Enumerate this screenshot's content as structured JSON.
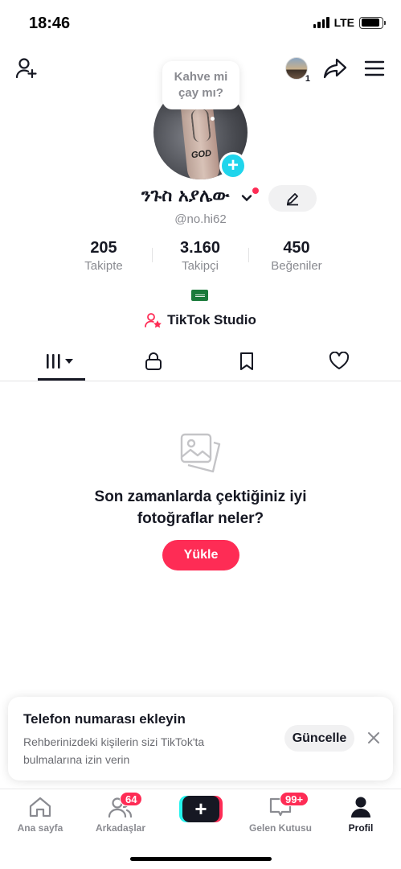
{
  "status_bar": {
    "time": "18:46",
    "network": "LTE",
    "battery_level": 0.9
  },
  "profile": {
    "bubble_text": "Kahve mi çay mı?",
    "avatar_tattoo_text": "GOD",
    "display_name": "ንጉስ አያሌው",
    "handle": "@no.hi62",
    "stats": [
      {
        "value": "205",
        "label": "Takipte"
      },
      {
        "value": "3.160",
        "label": "Takipçi"
      },
      {
        "value": "450",
        "label": "Beğeniler"
      }
    ],
    "flag_icon": "saudi-arabia-flag",
    "studio_label": "TikTok Studio"
  },
  "story": {
    "count": "1"
  },
  "tabs": [
    {
      "name": "videos-tab",
      "icon": "grid-bars-icon",
      "active": true
    },
    {
      "name": "private-tab",
      "icon": "lock-icon"
    },
    {
      "name": "saved-tab",
      "icon": "bookmark-icon"
    },
    {
      "name": "liked-tab",
      "icon": "heart-icon"
    }
  ],
  "empty_state": {
    "icon": "photos-icon",
    "title": "Son zamanlarda çektiğiniz iyi fotoğraflar neler?",
    "button": "Yükle"
  },
  "phone_card": {
    "title": "Telefon numarası ekleyin",
    "description": "Rehberinizdeki kişilerin sizi TikTok'ta bulmalarına izin verin",
    "button": "Güncelle"
  },
  "bottom_nav": {
    "home": "Ana sayfa",
    "friends": "Arkadaşlar",
    "friends_badge": "64",
    "inbox": "Gelen Kutusu",
    "inbox_badge": "99+",
    "profile": "Profil"
  },
  "colors": {
    "accent": "#fe2c55",
    "cyan": "#20d5ec",
    "text": "#161823",
    "muted": "#8a8b91"
  }
}
